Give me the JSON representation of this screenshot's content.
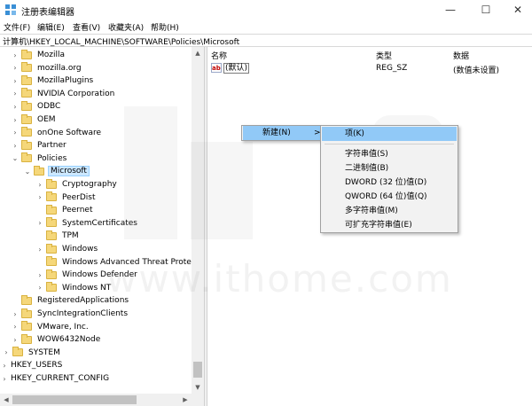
{
  "window": {
    "title": "注册表编辑器",
    "minimize": "—",
    "maximize": "☐",
    "close": "✕"
  },
  "menu": [
    "文件(F)",
    "编辑(E)",
    "查看(V)",
    "收藏夹(A)",
    "帮助(H)"
  ],
  "address": "计算机\\HKEY_LOCAL_MACHINE\\SOFTWARE\\Policies\\Microsoft",
  "tree": [
    {
      "label": "Mozilla",
      "level": 1,
      "chevron": "›"
    },
    {
      "label": "mozilla.org",
      "level": 1,
      "chevron": "›"
    },
    {
      "label": "MozillaPlugins",
      "level": 1,
      "chevron": "›"
    },
    {
      "label": "NVIDIA Corporation",
      "level": 1,
      "chevron": "›"
    },
    {
      "label": "ODBC",
      "level": 1,
      "chevron": "›"
    },
    {
      "label": "OEM",
      "level": 1,
      "chevron": "›"
    },
    {
      "label": "onOne Software",
      "level": 1,
      "chevron": "›"
    },
    {
      "label": "Partner",
      "level": 1,
      "chevron": "›"
    },
    {
      "label": "Policies",
      "level": 1,
      "chevron": "⌄"
    },
    {
      "label": "Microsoft",
      "level": 2,
      "chevron": "⌄",
      "selected": true
    },
    {
      "label": "Cryptography",
      "level": 3,
      "chevron": "›"
    },
    {
      "label": "PeerDist",
      "level": 3,
      "chevron": "›"
    },
    {
      "label": "Peernet",
      "level": 3,
      "chevron": ""
    },
    {
      "label": "SystemCertificates",
      "level": 3,
      "chevron": "›"
    },
    {
      "label": "TPM",
      "level": 3,
      "chevron": ""
    },
    {
      "label": "Windows",
      "level": 3,
      "chevron": "›"
    },
    {
      "label": "Windows Advanced Threat Protecti",
      "level": 3,
      "chevron": ""
    },
    {
      "label": "Windows Defender",
      "level": 3,
      "chevron": "›"
    },
    {
      "label": "Windows NT",
      "level": 3,
      "chevron": "›"
    },
    {
      "label": "RegisteredApplications",
      "level": 1,
      "chevron": ""
    },
    {
      "label": "SyncIntegrationClients",
      "level": 1,
      "chevron": "›"
    },
    {
      "label": "VMware, Inc.",
      "level": 1,
      "chevron": "›"
    },
    {
      "label": "WOW6432Node",
      "level": 1,
      "chevron": "›"
    },
    {
      "label": "SYSTEM",
      "level": 0,
      "chevron": "›"
    },
    {
      "label": "HKEY_USERS",
      "level": -1,
      "chevron": "›"
    },
    {
      "label": "HKEY_CURRENT_CONFIG",
      "level": -1,
      "chevron": "›"
    }
  ],
  "columns": {
    "name": "名称",
    "type": "类型",
    "data": "数据"
  },
  "values": [
    {
      "icon": "ab",
      "name": "(默认)",
      "type": "REG_SZ",
      "data": "(数值未设置)"
    }
  ],
  "context_menu": {
    "new_label": "新建(N)",
    "new_arrow": ">",
    "submenu": [
      {
        "label": "项(K)",
        "highlighted": true
      },
      {
        "separator": true
      },
      {
        "label": "字符串值(S)"
      },
      {
        "label": "二进制值(B)"
      },
      {
        "label": "DWORD (32 位)值(D)"
      },
      {
        "label": "QWORD (64 位)值(Q)"
      },
      {
        "label": "多字符串值(M)"
      },
      {
        "label": "可扩充字符串值(E)"
      }
    ]
  },
  "watermark": "www.ithome.com",
  "colors": {
    "highlight": "#91c9f7",
    "selected_bg": "#cce8ff",
    "folder": "#f5d77a"
  }
}
